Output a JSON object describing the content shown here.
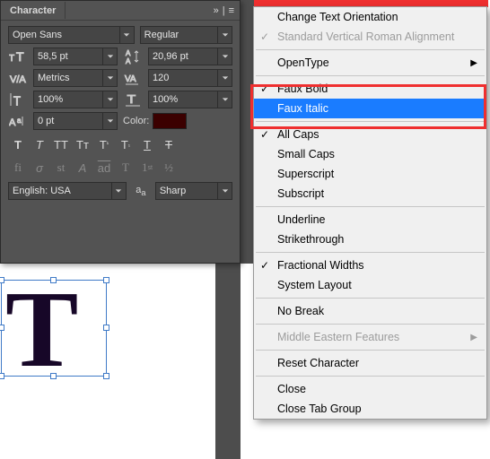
{
  "header": {
    "title": "Character"
  },
  "font": {
    "family": "Open Sans",
    "style": "Regular"
  },
  "fields": {
    "size": "58,5 pt",
    "leading": "20,96 pt",
    "kerning": "Metrics",
    "tracking": "120",
    "vscale": "100%",
    "hscale": "100%",
    "baseline": "0 pt",
    "colorLabel": "Color:"
  },
  "colors": {
    "text_swatch": "#3b0000",
    "highlight_border": "#ef2f2f",
    "menu_highlight": "#1a7cff"
  },
  "language": {
    "value": "English: USA",
    "aa": "Sharp"
  },
  "menu": {
    "change_orient": "Change Text Orientation",
    "std_vert": "Standard Vertical Roman Alignment",
    "opentype": "OpenType",
    "faux_bold": "Faux Bold",
    "faux_italic": "Faux Italic",
    "all_caps": "All Caps",
    "small_caps": "Small Caps",
    "superscript": "Superscript",
    "subscript": "Subscript",
    "underline": "Underline",
    "strike": "Strikethrough",
    "frac_widths": "Fractional Widths",
    "sys_layout": "System Layout",
    "no_break": "No Break",
    "me_feats": "Middle Eastern Features",
    "reset": "Reset Character",
    "close": "Close",
    "close_group": "Close Tab Group"
  },
  "canvas": {
    "glyph": "T"
  }
}
